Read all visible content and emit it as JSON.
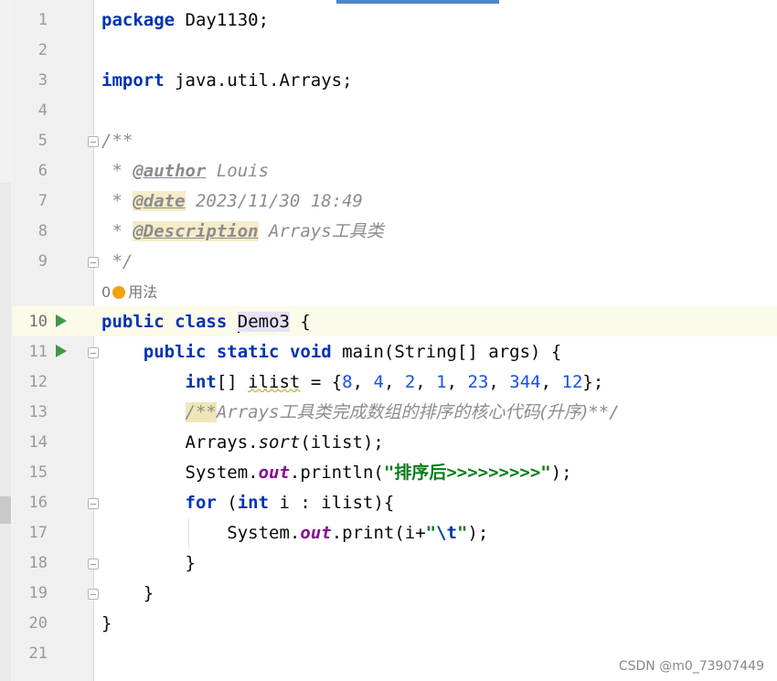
{
  "editor": {
    "line_numbers": [
      "1",
      "2",
      "3",
      "4",
      "5",
      "6",
      "7",
      "8",
      "9",
      "10",
      "11",
      "12",
      "13",
      "14",
      "15",
      "16",
      "17",
      "18",
      "19",
      "20",
      "21"
    ],
    "code": {
      "l1_kw": "package",
      "l1_rest": " Day1130;",
      "l3_kw": "import",
      "l3_rest": " java.util.Arrays;",
      "l5": "/**",
      "l6_star": " * ",
      "l6_tag": "@author",
      "l6_rest": " Louis",
      "l7_star": " * ",
      "l7_tag": "@date",
      "l7_rest": " 2023/11/30 18:49",
      "l8_star": " * ",
      "l8_tag": "@Description",
      "l8_rest_a": " Arrays",
      "l8_rest_b": "工具类",
      "l9": " */",
      "l10_kw1": "public",
      "l10_kw2": "class",
      "l10_cls_a": "",
      "l10_cls_b": "Demo3",
      "l10_rest": " {",
      "l11_indent": "    ",
      "l11_kw1": "public",
      "l11_kw2": "static",
      "l11_kw3": "void",
      "l11_rest": " main(String[] args) {",
      "l12_indent": "        ",
      "l12_kw": "int",
      "l12_a": "[] ",
      "l12_var": "ilist",
      "l12_b": " = {",
      "l12_n1": "8",
      "l12_n2": "4",
      "l12_n3": "2",
      "l12_n4": "1",
      "l12_n5": "23",
      "l12_n6": "344",
      "l12_n7": "12",
      "l12_c": "};",
      "l13_indent": "        ",
      "l13_open": "/**",
      "l13_text_a": "Arrays",
      "l13_text_b": "工具类完成数组的排序的核心代码(升序)",
      "l13_close": "**/",
      "l14_indent": "        ",
      "l14_a": "Arrays.",
      "l14_m": "sort",
      "l14_b": "(ilist);",
      "l15_indent": "        ",
      "l15_a": "System.",
      "l15_f": "out",
      "l15_b": ".println(",
      "l15_str_a": "\"",
      "l15_str_b": "排序后",
      "l15_str_c": ">>>>>>>>>\"",
      "l15_c": ");",
      "l16_indent": "        ",
      "l16_kw1": "for",
      "l16_a": " (",
      "l16_kw2": "int",
      "l16_b": " i : ilist){",
      "l17_indent": "            ",
      "l17_a": "System.",
      "l17_f": "out",
      "l17_b": ".print(i+",
      "l17_s1": "\"",
      "l17_esc": "\\t",
      "l17_s2": "\"",
      "l17_c": ");",
      "l18_indent": "        ",
      "l18": "}",
      "l19_indent": "    ",
      "l19": "}",
      "l20": "}"
    },
    "usage_hint": {
      "count": "0",
      "label": "用法"
    }
  },
  "watermark": "CSDN @m0_73907449",
  "colors": {
    "keyword": "#0033b3",
    "number": "#1750eb",
    "string": "#067d17",
    "comment": "#8c8c8c",
    "field": "#871094",
    "run": "#3e9a48"
  }
}
